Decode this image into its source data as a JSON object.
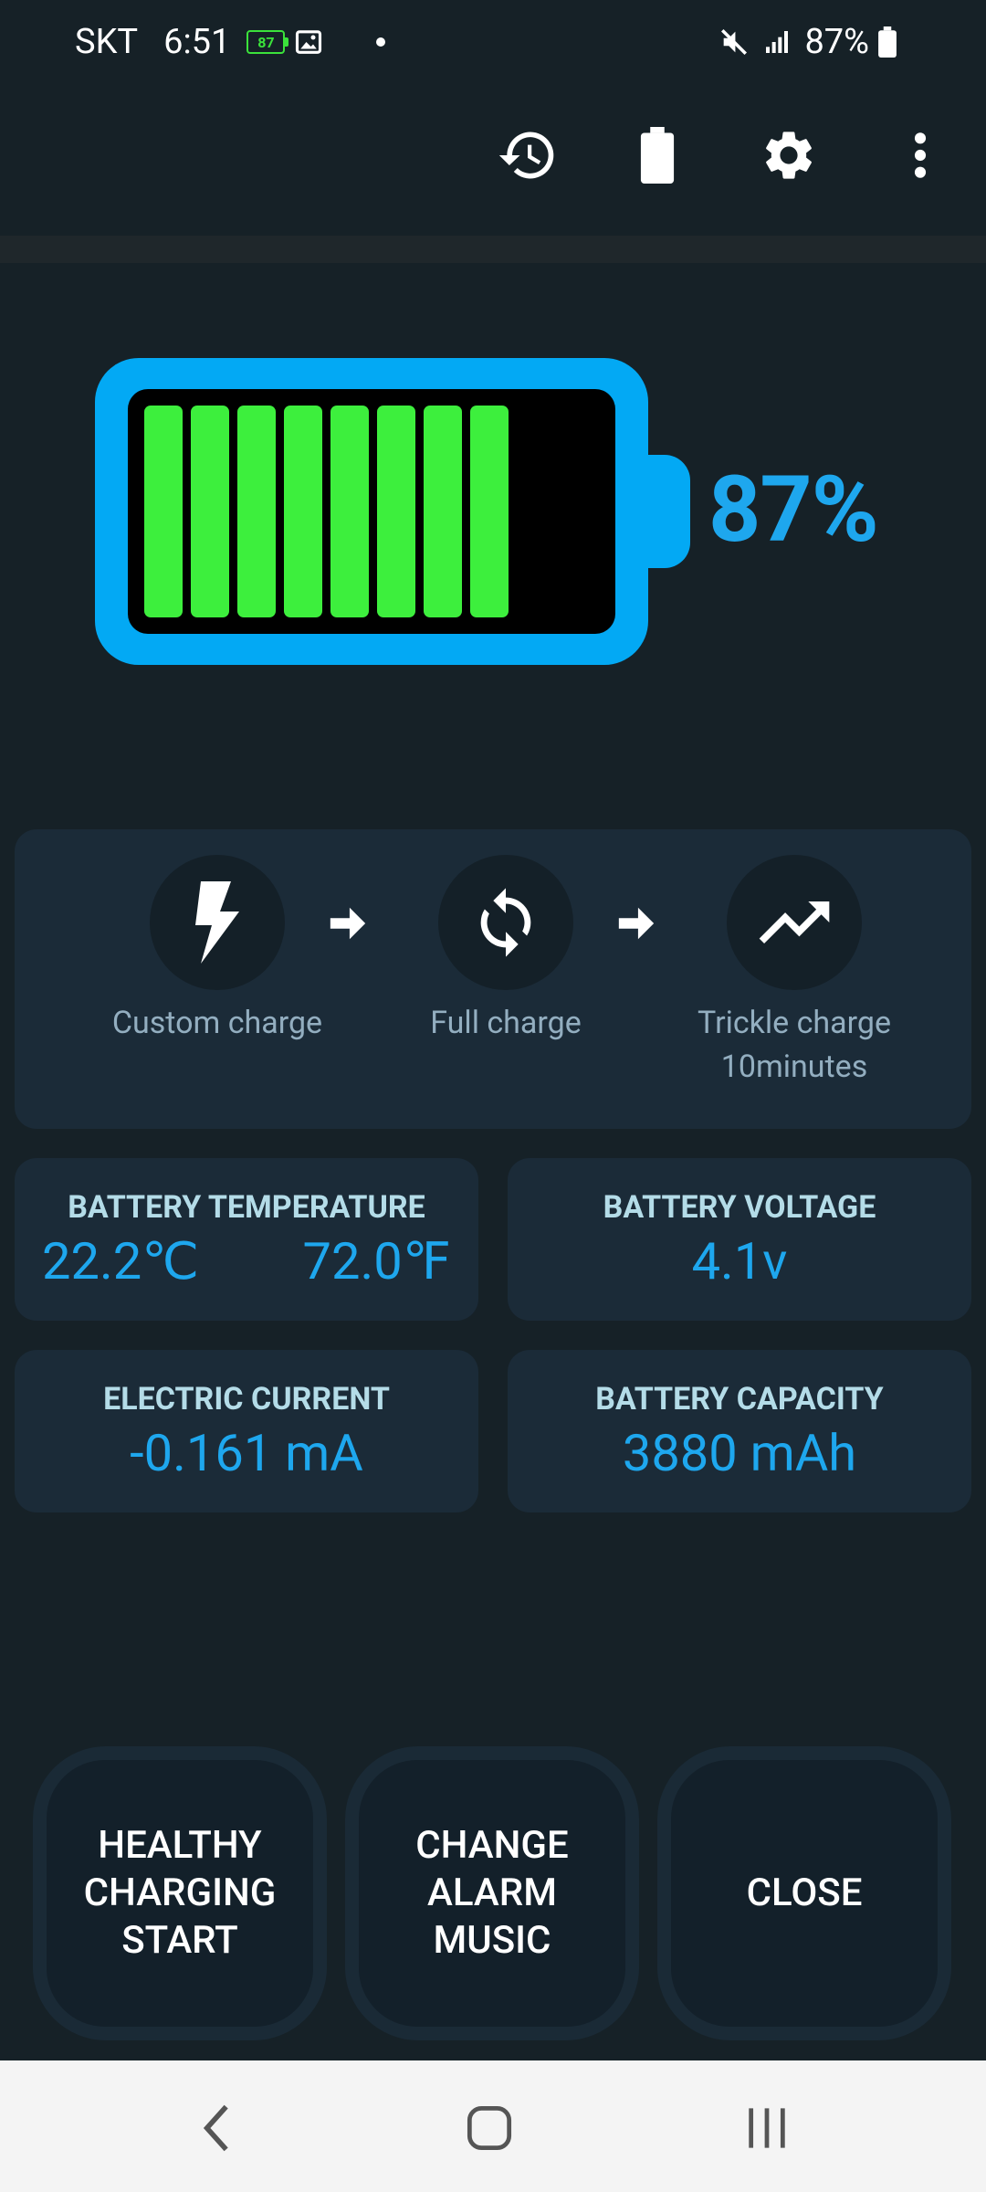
{
  "status_bar": {
    "carrier": "SKT",
    "time": "6:51",
    "mini_battery": "87",
    "battery_percent": "87%"
  },
  "toolbar": {
    "icons": [
      "history-icon",
      "battery-icon",
      "settings-icon",
      "more-vert-icon"
    ]
  },
  "battery": {
    "level_percent": 87,
    "bars_filled": 8,
    "bars_total": 10,
    "percent_label": "87%",
    "colors": {
      "frame": "#03a9f4",
      "bar": "#3def3d",
      "inner": "#000000"
    }
  },
  "process": {
    "steps": [
      {
        "icon": "lightning-bolt-icon",
        "label": "Custom charge"
      },
      {
        "icon": "sync-icon",
        "label": "Full charge"
      },
      {
        "icon": "trending-up-icon",
        "label": "Trickle charge\n10minutes"
      }
    ]
  },
  "stats": {
    "temperature": {
      "title": "BATTERY TEMPERATURE",
      "celsius": "22.2℃",
      "fahrenheit": "72.0℉"
    },
    "voltage": {
      "title": "BATTERY VOLTAGE",
      "value": "4.1v"
    },
    "current": {
      "title": "ELECTRIC CURRENT",
      "value": "-0.161 mA"
    },
    "capacity": {
      "title": "BATTERY CAPACITY",
      "value": "3880 mAh"
    }
  },
  "actions": {
    "healthy": "HEALTHY\nCHARGING\nSTART",
    "alarm": "CHANGE\nALARM\nMUSIC",
    "close": "CLOSE"
  },
  "nav": {
    "icons": [
      "back-icon",
      "home-icon",
      "recents-icon"
    ]
  }
}
